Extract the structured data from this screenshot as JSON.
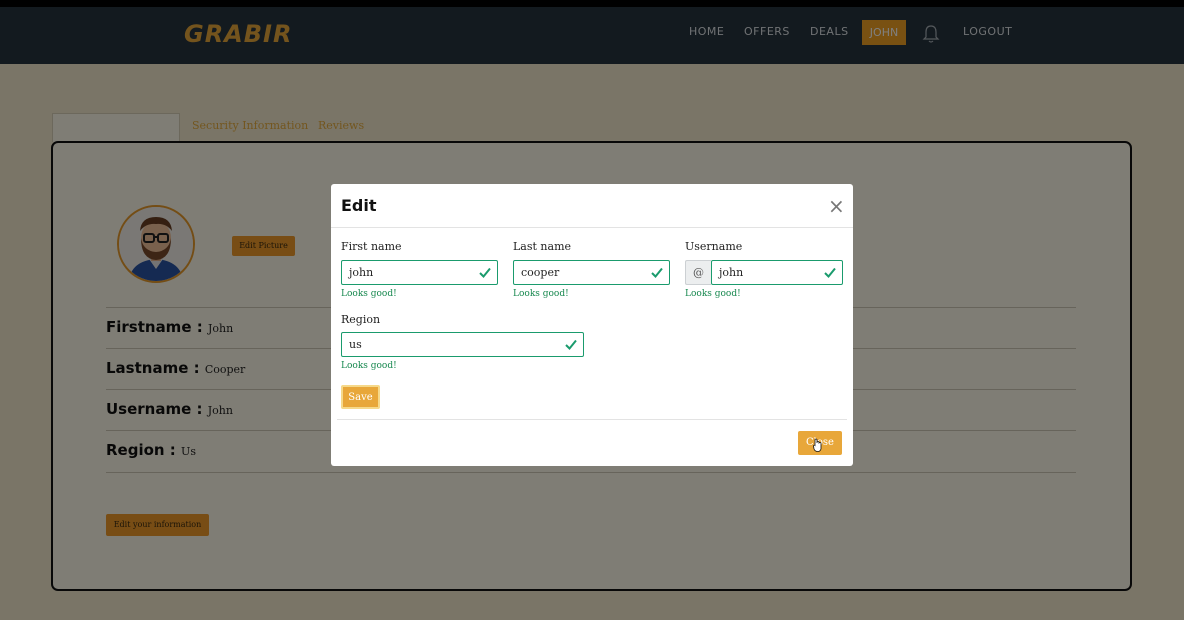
{
  "navbar": {
    "brand": "GRABIR",
    "links": [
      "HOME",
      "OFFERS",
      "DEALS"
    ],
    "user": "JOHN",
    "logout": "LOGOUT"
  },
  "tabs": [
    "Security Information",
    "Reviews"
  ],
  "profile": {
    "edit_picture": "Edit Picture",
    "rows": [
      {
        "label": "Firstname :",
        "value": "John"
      },
      {
        "label": "Lastname :",
        "value": "Cooper"
      },
      {
        "label": "Username :",
        "value": "John"
      },
      {
        "label": "Region :",
        "value": "Us"
      }
    ],
    "edit_info": "Edit your information"
  },
  "modal": {
    "title": "Edit",
    "close_icon": "×",
    "first_name_label": "First name",
    "first_name": "john",
    "last_name_label": "Last name",
    "last_name": "cooper",
    "username_label": "Username",
    "username_prefix": "@",
    "username": "john",
    "region_label": "Region",
    "region": "us",
    "valid_feedback": "Looks good!",
    "save": "Save",
    "close": "Close"
  },
  "colors": {
    "accent": "#e8a73a",
    "navbar": "#26343f",
    "valid": "#1a9b6d"
  }
}
